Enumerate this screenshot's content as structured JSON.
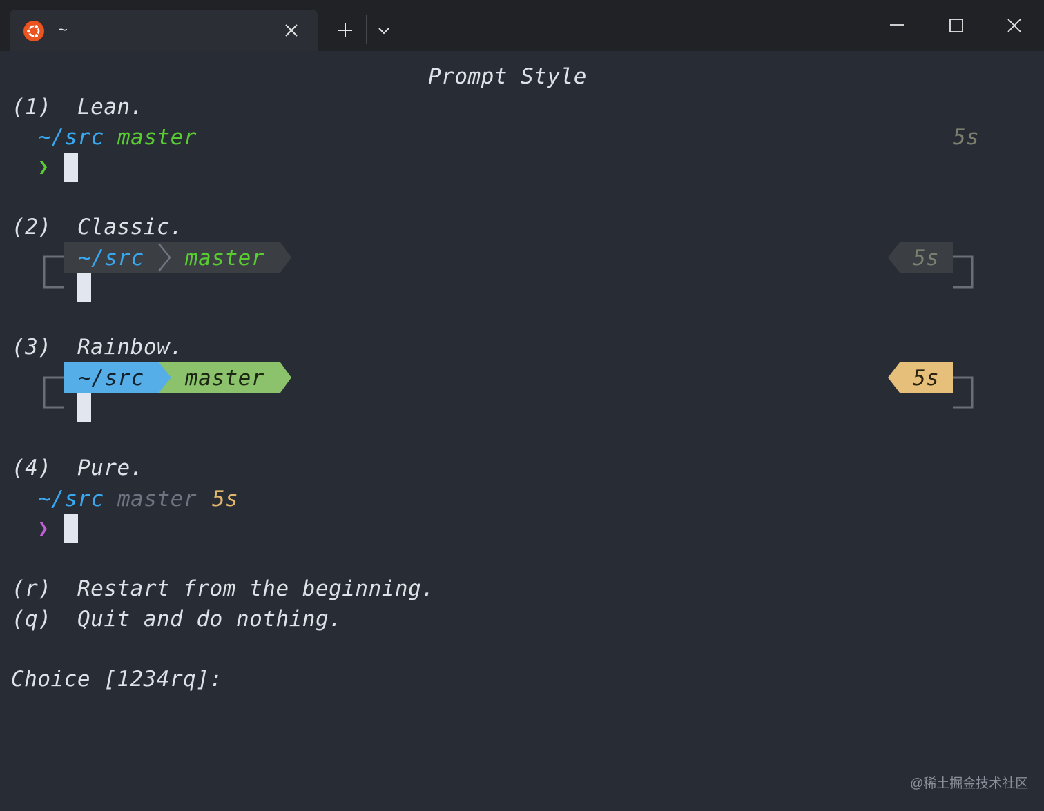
{
  "window": {
    "tab_title": "~",
    "watermark": "@稀土掘金技术社区"
  },
  "colors": {
    "background": "#282c34",
    "dir_blue": "#38a9f0",
    "branch_green": "#59cc32",
    "pure_prompt_purple": "#c15fd6",
    "rainbow_dir_bg": "#56aee8",
    "rainbow_branch_bg": "#8cc26c",
    "rainbow_time_bg": "#e6c07a",
    "classic_segment_bg": "#3b3e43"
  },
  "terminal": {
    "heading": "Prompt Style",
    "options": [
      {
        "key": "(1)",
        "label": "Lean.",
        "dir": "~/src",
        "branch": "master",
        "duration": "5s",
        "prompt_char": "❯"
      },
      {
        "key": "(2)",
        "label": "Classic.",
        "dir": "~/src",
        "branch": "master",
        "duration": "5s"
      },
      {
        "key": "(3)",
        "label": "Rainbow.",
        "dir": "~/src",
        "branch": "master",
        "duration": "5s"
      },
      {
        "key": "(4)",
        "label": "Pure.",
        "dir": "~/src",
        "branch": "master",
        "duration": "5s",
        "prompt_char": "❯"
      }
    ],
    "restart": {
      "key": "(r)",
      "label": "Restart from the beginning."
    },
    "quit": {
      "key": "(q)",
      "label": "Quit and do nothing."
    },
    "choice_prompt": "Choice [1234rq]:"
  }
}
